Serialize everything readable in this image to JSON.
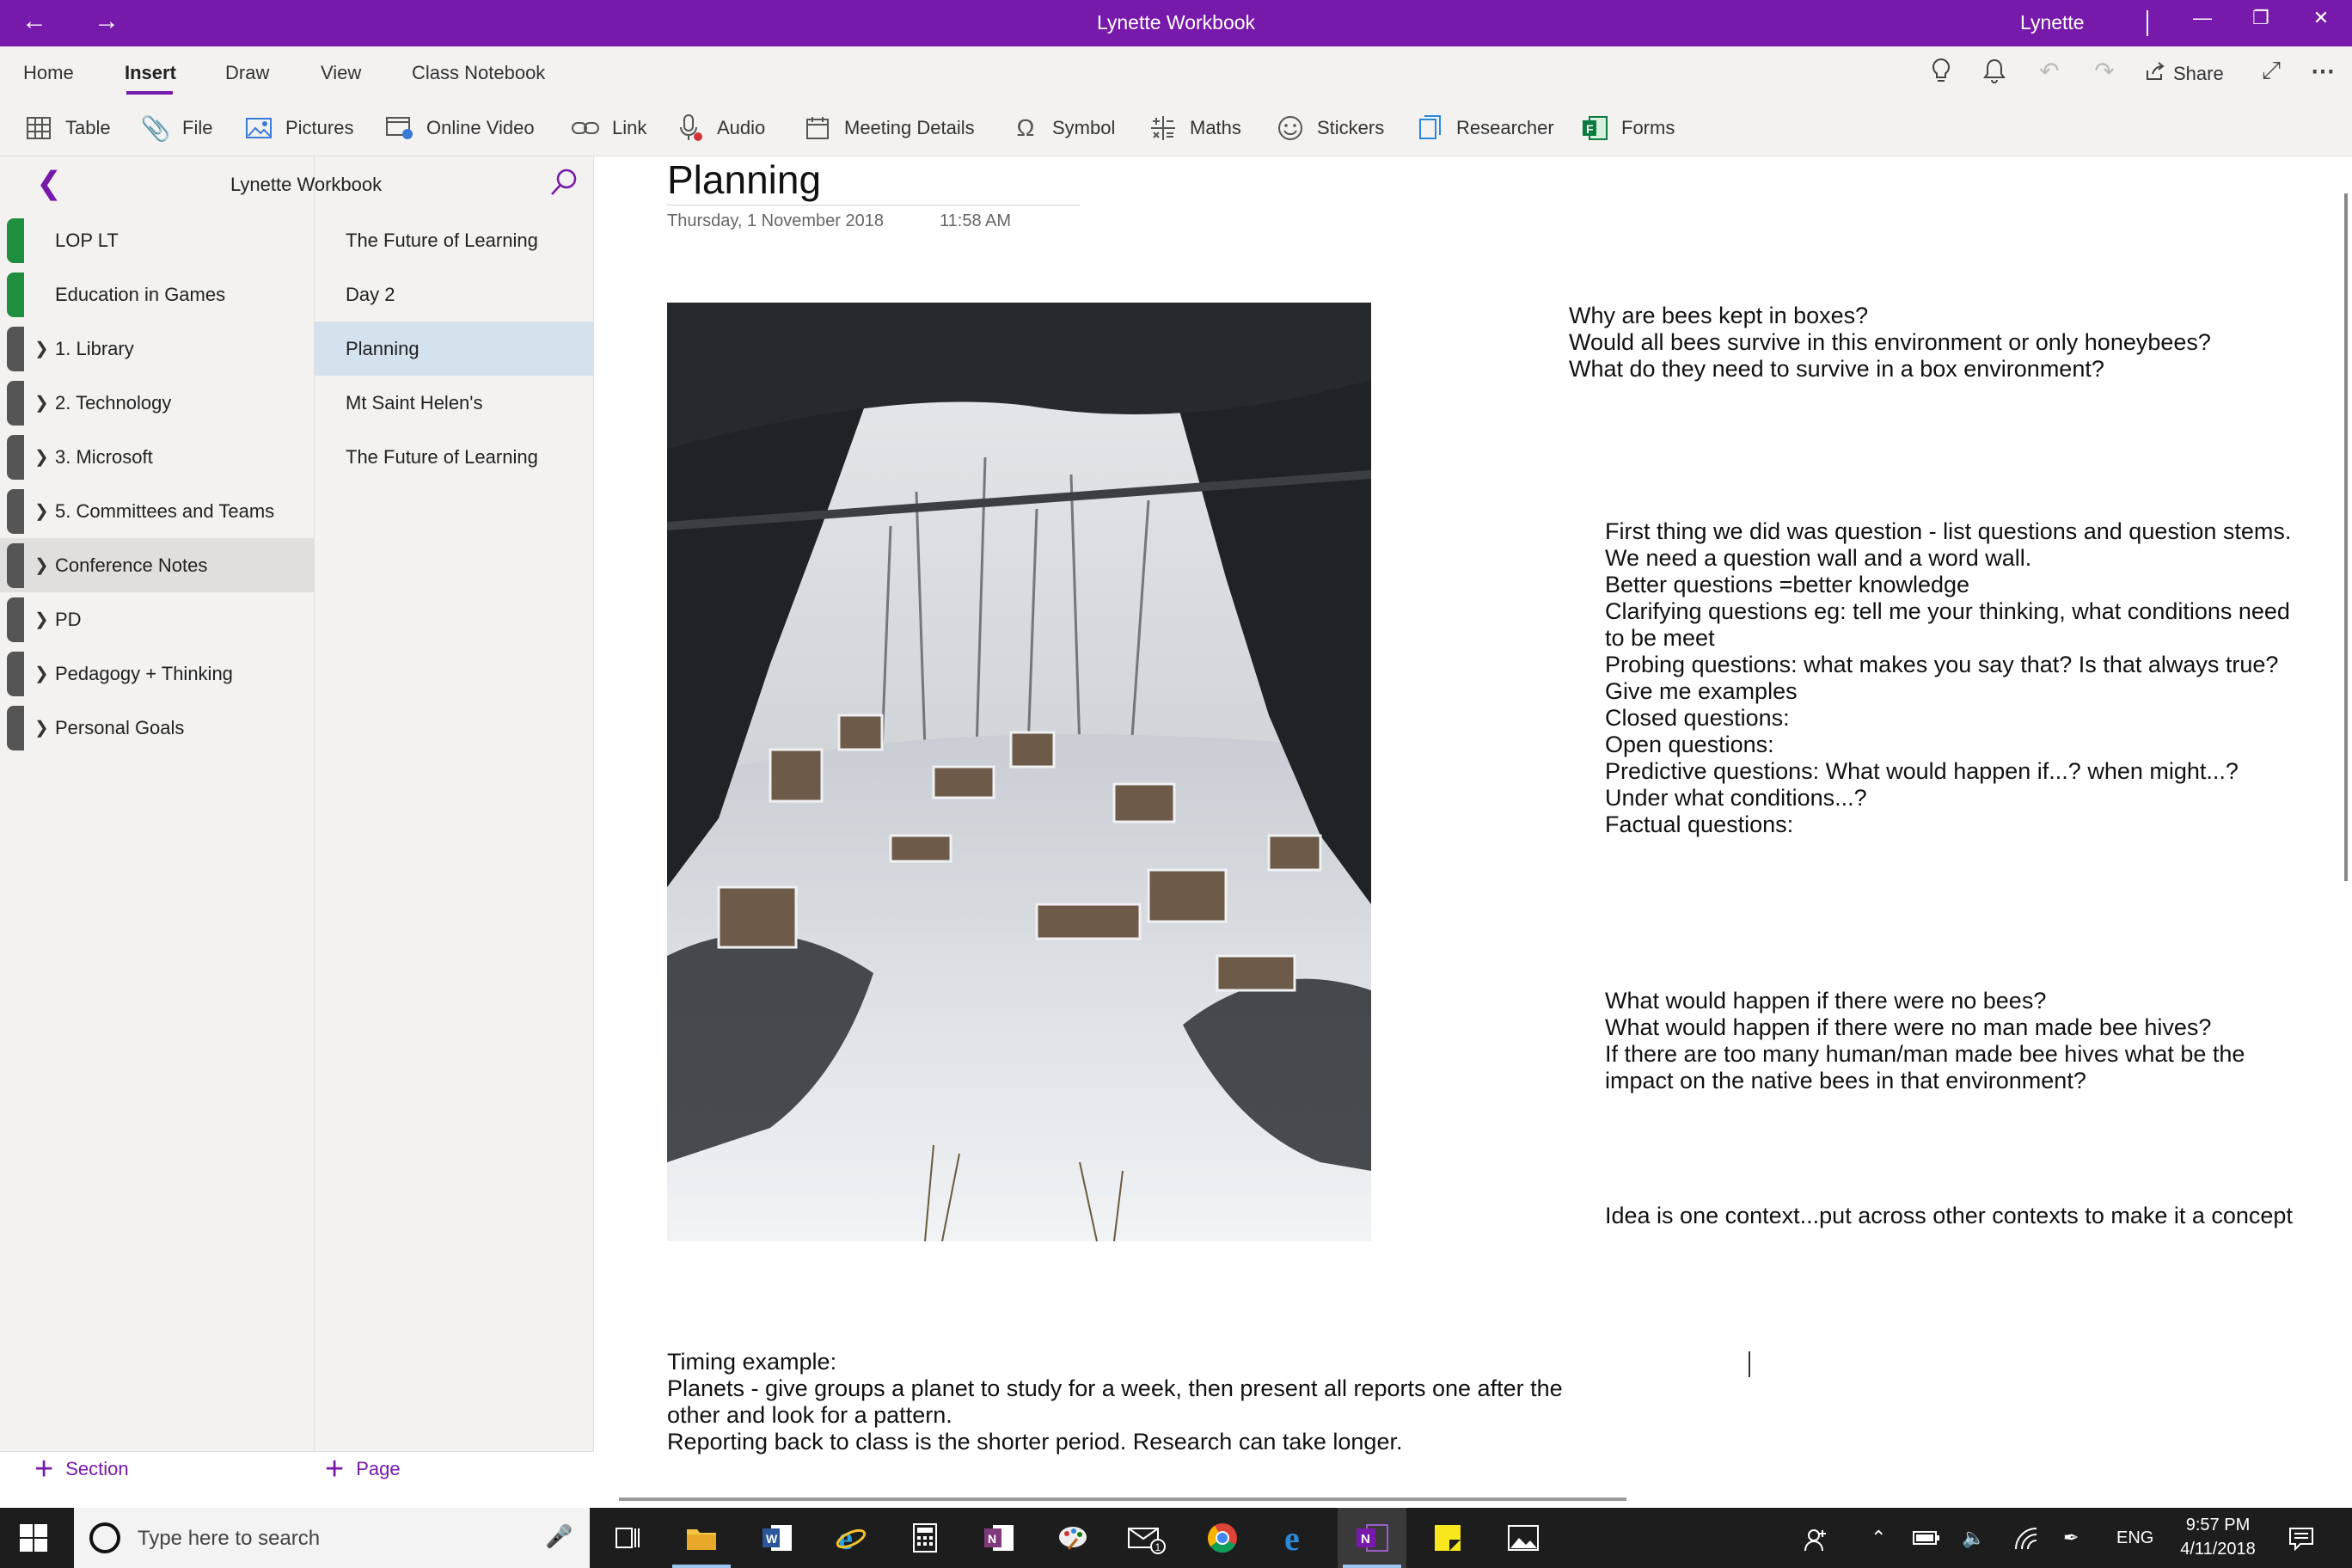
{
  "window": {
    "title": "Lynette Workbook",
    "user": "Lynette"
  },
  "ribbon": {
    "tabs": [
      "Home",
      "Insert",
      "Draw",
      "View",
      "Class Notebook"
    ],
    "active_tab": "Insert",
    "share_label": "Share",
    "tools": [
      "Table",
      "File",
      "Pictures",
      "Online Video",
      "Link",
      "Audio",
      "Meeting Details",
      "Symbol",
      "Maths",
      "Stickers",
      "Researcher",
      "Forms"
    ]
  },
  "notebook": {
    "name": "Lynette Workbook",
    "sections": [
      {
        "label": "LOP LT",
        "color": "#1e8f3e",
        "expandable": false
      },
      {
        "label": "Education in Games",
        "color": "#1e8f3e",
        "expandable": false
      },
      {
        "label": "1. Library",
        "color": "#555555",
        "expandable": true
      },
      {
        "label": "2. Technology",
        "color": "#555555",
        "expandable": true
      },
      {
        "label": "3. Microsoft",
        "color": "#555555",
        "expandable": true
      },
      {
        "label": "5. Committees and Teams",
        "color": "#555555",
        "expandable": true
      },
      {
        "label": "Conference Notes",
        "color": "#555555",
        "expandable": true,
        "selected": true
      },
      {
        "label": "PD",
        "color": "#555555",
        "expandable": true
      },
      {
        "label": "Pedagogy + Thinking",
        "color": "#555555",
        "expandable": true
      },
      {
        "label": "Personal Goals",
        "color": "#555555",
        "expandable": true
      }
    ],
    "pages": [
      {
        "label": "The Future of Learning"
      },
      {
        "label": "Day 2"
      },
      {
        "label": "Planning",
        "selected": true
      },
      {
        "label": "Mt Saint Helen's"
      },
      {
        "label": "The Future of Learning"
      }
    ],
    "add_section_label": "Section",
    "add_page_label": "Page"
  },
  "page": {
    "title": "Planning",
    "date": "Thursday, 1 November 2018",
    "time": "11:58 AM",
    "note1": [
      "Why are bees kept in boxes?",
      "Would all bees survive in this environment or only honeybees?",
      "What do they need to survive in a box environment?"
    ],
    "note2": [
      "First thing we did was question - list questions and question stems.",
      "We need a question wall and a word wall.",
      "Better questions =better knowledge",
      "Clarifying questions eg: tell me your thinking, what conditions need",
      "to be meet",
      "Probing questions: what makes you say that? Is that always true?",
      "Give me examples",
      "Closed questions:",
      "Open questions:",
      "Predictive questions: What would happen if...? when might...?",
      "Under what conditions...?",
      "Factual questions:"
    ],
    "note3": [
      "What would happen if there were no bees?",
      "What would happen if there were no man made bee hives?",
      "If there are too many human/man made bee hives what be the",
      "impact on the native bees in that environment?"
    ],
    "note4": [
      "Idea is one context...put across other contexts to make it a concept"
    ],
    "note5": [
      "Timing example:",
      "Planets - give groups a planet to study for a week, then present all reports one after the",
      "other and look for a pattern.",
      "Reporting back to class is the shorter period. Research can take longer."
    ]
  },
  "taskbar": {
    "search_placeholder": "Type here to search",
    "language": "ENG",
    "time": "9:57 PM",
    "date": "4/11/2018",
    "mail_badge": "1"
  },
  "colors": {
    "accent": "#7719aa",
    "selected_page": "#d4e2ee",
    "selected_section": "#e1dfdd"
  }
}
